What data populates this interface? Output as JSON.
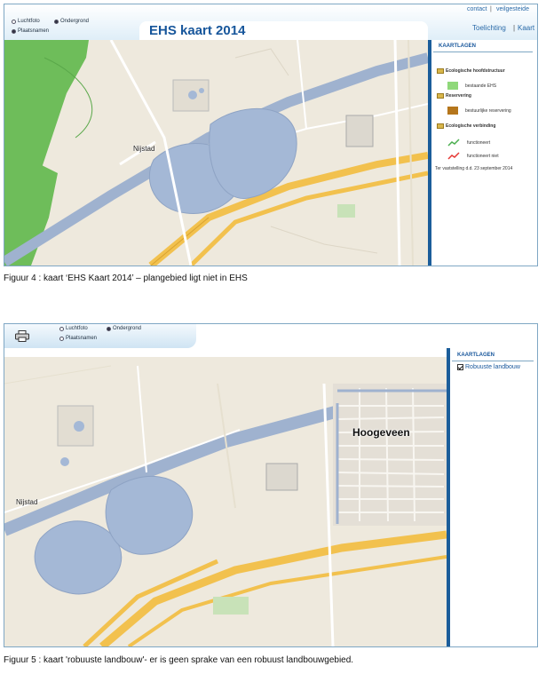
{
  "fig4": {
    "layers": {
      "luchtfoto": "Luchtfoto",
      "ondergrond": "Ondergrond",
      "plaatsnamen": "Plaatsnamen",
      "selected": "Ondergrond"
    },
    "top_links": {
      "contact": "contact",
      "separator": "|",
      "veilgesteld": "veilgesteide"
    },
    "title": "EHS kaart 2014",
    "nav": {
      "toelichting": "Toelichting",
      "separator": "|",
      "kaart": "Kaart"
    },
    "panel": {
      "heading": "KAARTLAGEN",
      "categories": [
        {
          "label": "Ecologische hoofdstructuur",
          "items": [
            {
              "label": "bestaande EHS",
              "color": "#8fd87a"
            }
          ]
        },
        {
          "label": "Reservering",
          "items": [
            {
              "label": "bestuurlijke reservering",
              "color": "#b5761c"
            }
          ]
        },
        {
          "label": "Ecologische verbinding",
          "items": [
            {
              "label": "functioneert",
              "color": "#4caf50"
            },
            {
              "label": "functioneert niet",
              "color": "#e53935"
            }
          ]
        }
      ],
      "footer": "Ter vaststelling d.d. 23 september 2014"
    },
    "map": {
      "place": "Nijstad"
    },
    "caption": "Figuur 4 : kaart ‘EHS Kaart 2014’ – plangebied ligt niet in EHS"
  },
  "fig5": {
    "layers": {
      "luchtfoto": "Luchtfoto",
      "ondergrond": "Ondergrond",
      "plaatsnamen": "Plaatsnamen",
      "selected": "Ondergrond"
    },
    "icon": "print-icon",
    "panel": {
      "heading": "KAARTLAGEN",
      "layer": {
        "label": "Robuuste landbouw",
        "checked": true
      }
    },
    "map": {
      "place": "Nijstad",
      "city": "Hoogeveen"
    },
    "caption": "Figuur 5 : kaart 'robuuste landbouw'- er is geen sprake van een robuust landbouwgebied."
  },
  "colors": {
    "brand_blue": "#17569b",
    "water": "#a4b8d6",
    "ehs_green": "#6ebd5a",
    "road_orange": "#f2c14e",
    "canal": "#9fb2cf"
  }
}
